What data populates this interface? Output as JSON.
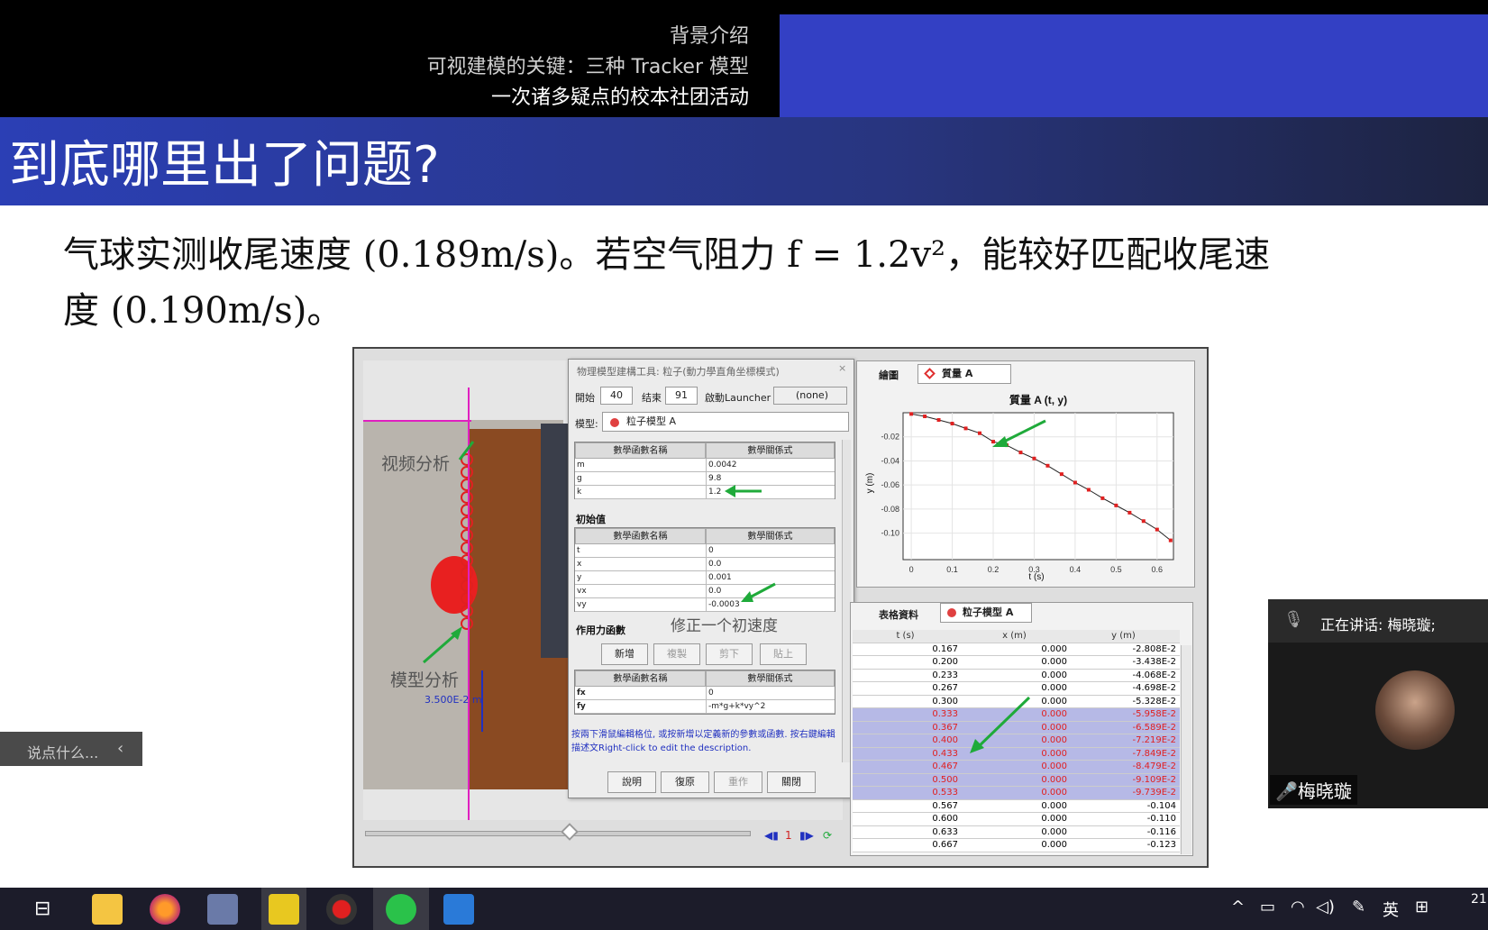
{
  "nav": {
    "item1": "背景介绍",
    "item2": "可视建模的关键：三种 Tracker 模型",
    "item3": "一次诸多疑点的校本社团活动"
  },
  "slide": {
    "title": "到底哪里出了问题?",
    "line1": "气球实测收尾速度 (0.189m/s)。若空气阻力 f = 1.2v²，能较好匹配收尾速",
    "line2": "度 (0.190m/s)。"
  },
  "video": {
    "label_video": "视频分析",
    "label_model": "模型分析",
    "scale": "3.500E-2 m",
    "frame": "1"
  },
  "dialog": {
    "title": "物理模型建構工具: 粒子(動力學直角坐標模式)",
    "start_label": "開始",
    "start_val": "40",
    "end_label": "结束",
    "end_val": "91",
    "launcher_label": "啟動Launcher",
    "launcher_val": "(none)",
    "model_label": "模型:",
    "model_val": "粒子模型 A",
    "col_name": "數學函數名稱",
    "col_expr": "數學關係式",
    "params": [
      {
        "n": "m",
        "v": "0.0042"
      },
      {
        "n": "g",
        "v": "9.8"
      },
      {
        "n": "k",
        "v": "1.2"
      }
    ],
    "init_title": "初始值",
    "inits": [
      {
        "n": "t",
        "v": "0"
      },
      {
        "n": "x",
        "v": "0.0"
      },
      {
        "n": "y",
        "v": "0.001"
      },
      {
        "n": "vx",
        "v": "0.0"
      },
      {
        "n": "vy",
        "v": "-0.0003"
      }
    ],
    "force_title": "作用力函數",
    "btn_new": "新增",
    "btn_copy": "複製",
    "btn_cut": "剪下",
    "btn_paste": "貼上",
    "forces": [
      {
        "n": "fx",
        "v": "0"
      },
      {
        "n": "fy",
        "v": "-m*g+k*vy^2"
      }
    ],
    "help": "按兩下滑鼠編輯格位, 或按新增以定義新的參數或函數. 按右鍵編輯描述文Right-click to edit the description.",
    "btn_help": "說明",
    "btn_undo": "復原",
    "btn_redo": "重作",
    "btn_close": "關閉"
  },
  "callout": "修正一个初速度",
  "graph": {
    "menu": "繪圖",
    "track": "質量 A",
    "title": "質量 A (t, y)",
    "ylabel": "y (m)",
    "xlabel": "t (s)"
  },
  "chart_data": {
    "type": "line",
    "title": "質量 A (t, y)",
    "xlabel": "t (s)",
    "ylabel": "y (m)",
    "xlim": [
      -0.02,
      0.64
    ],
    "ylim": [
      -0.122,
      0.0
    ],
    "xticks": [
      "0",
      "0.1",
      "0.2",
      "0.3",
      "0.4",
      "0.5",
      "0.6"
    ],
    "yticks": [
      "-0.02",
      "-0.04",
      "-0.06",
      "-0.08",
      "-0.10"
    ],
    "x": [
      0,
      0.033,
      0.067,
      0.1,
      0.133,
      0.167,
      0.2,
      0.233,
      0.267,
      0.3,
      0.333,
      0.367,
      0.4,
      0.433,
      0.467,
      0.5,
      0.533,
      0.567,
      0.6,
      0.633
    ],
    "y": [
      -0.001,
      -0.003,
      -0.006,
      -0.009,
      -0.013,
      -0.017,
      -0.024,
      -0.027,
      -0.033,
      -0.038,
      -0.044,
      -0.051,
      -0.058,
      -0.064,
      -0.071,
      -0.077,
      -0.083,
      -0.09,
      -0.097,
      -0.106
    ]
  },
  "table": {
    "menu": "表格資料",
    "track": "粒子模型 A",
    "headers": [
      "t (s)",
      "x (m)",
      "y (m)"
    ],
    "rows": [
      [
        "0.167",
        "0.000",
        "-2.808E-2"
      ],
      [
        "0.200",
        "0.000",
        "-3.438E-2"
      ],
      [
        "0.233",
        "0.000",
        "-4.068E-2"
      ],
      [
        "0.267",
        "0.000",
        "-4.698E-2"
      ],
      [
        "0.300",
        "0.000",
        "-5.328E-2"
      ],
      [
        "0.333",
        "0.000",
        "-5.958E-2"
      ],
      [
        "0.367",
        "0.000",
        "-6.589E-2"
      ],
      [
        "0.400",
        "0.000",
        "-7.219E-2"
      ],
      [
        "0.433",
        "0.000",
        "-7.849E-2"
      ],
      [
        "0.467",
        "0.000",
        "-8.479E-2"
      ],
      [
        "0.500",
        "0.000",
        "-9.109E-2"
      ],
      [
        "0.533",
        "0.000",
        "-9.739E-2"
      ],
      [
        "0.567",
        "0.000",
        "-0.104"
      ],
      [
        "0.600",
        "0.000",
        "-0.110"
      ],
      [
        "0.633",
        "0.000",
        "-0.116"
      ],
      [
        "0.667",
        "0.000",
        "-0.123"
      ]
    ]
  },
  "chat": "说点什么...",
  "meeting": {
    "speaking": "正在讲话: 梅晓璇;",
    "name": "梅晓璇"
  },
  "taskbar": {
    "ime": "英",
    "clock": "21"
  }
}
